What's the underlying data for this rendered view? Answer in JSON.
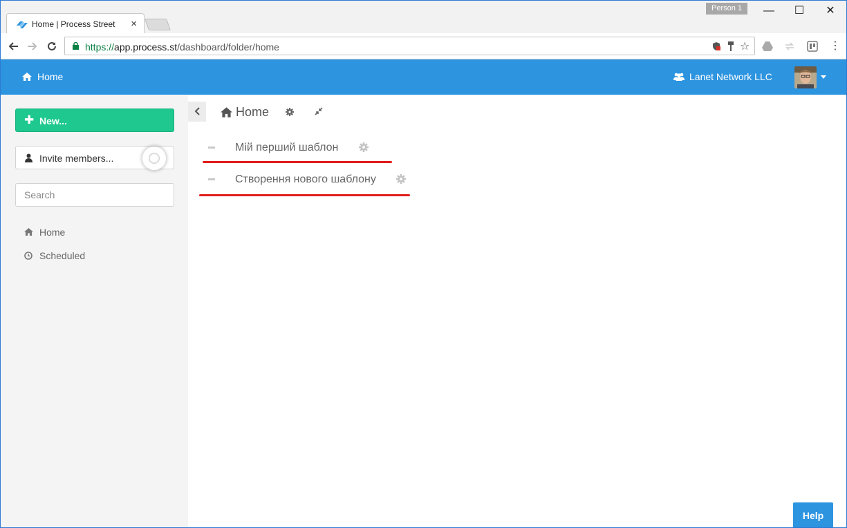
{
  "browser": {
    "tab_title": "Home | Process Street",
    "tab_close": "×",
    "profile": "Person 1",
    "url_scheme": "https://",
    "url_host": "app.process.st",
    "url_path": "/dashboard/folder/home",
    "window_min": "—",
    "window_max": "☐",
    "window_close": "✕"
  },
  "header": {
    "home_label": "Home",
    "org_label": "Lanet Network LLC",
    "accent": "#2d94e0"
  },
  "sidebar": {
    "new_label": "New...",
    "invite_label": "Invite members...",
    "search_placeholder": "Search",
    "nav": [
      {
        "label": "Home",
        "icon": "home-icon"
      },
      {
        "label": "Scheduled",
        "icon": "clock-icon"
      }
    ]
  },
  "main": {
    "breadcrumb": "Home",
    "templates": [
      {
        "name": "Мій перший шаблон"
      },
      {
        "name": "Створення нового шаблону"
      }
    ]
  },
  "help_label": "Help"
}
